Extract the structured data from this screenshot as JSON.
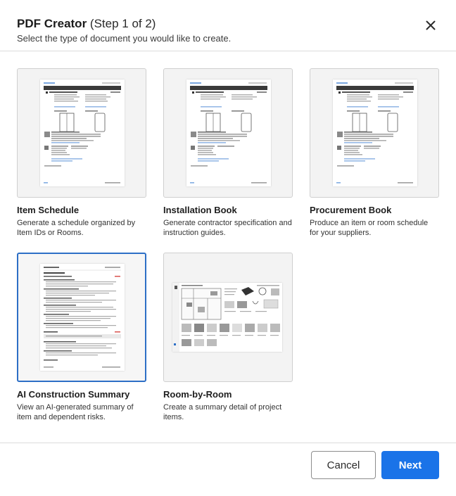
{
  "header": {
    "title": "PDF Creator",
    "step": "(Step 1 of 2)",
    "subtitle": "Select the type of document you would like to create."
  },
  "close_icon": "close-icon",
  "options": [
    {
      "title": "Item Schedule",
      "description": "Generate a schedule organized by Item IDs or Rooms.",
      "selected": false
    },
    {
      "title": "Installation Book",
      "description": "Generate contractor specification and instruction guides.",
      "selected": false
    },
    {
      "title": "Procurement Book",
      "description": "Produce an item or room schedule for your suppliers.",
      "selected": false
    },
    {
      "title": "AI Construction Summary",
      "description": "View an AI-generated summary of item and dependent risks.",
      "selected": true
    },
    {
      "title": "Room-by-Room",
      "description": "Create a summary detail of project items.",
      "selected": false
    }
  ],
  "footer": {
    "cancel_label": "Cancel",
    "next_label": "Next"
  },
  "colors": {
    "accent": "#1a73e8",
    "selected_border": "#2d6fc6"
  }
}
